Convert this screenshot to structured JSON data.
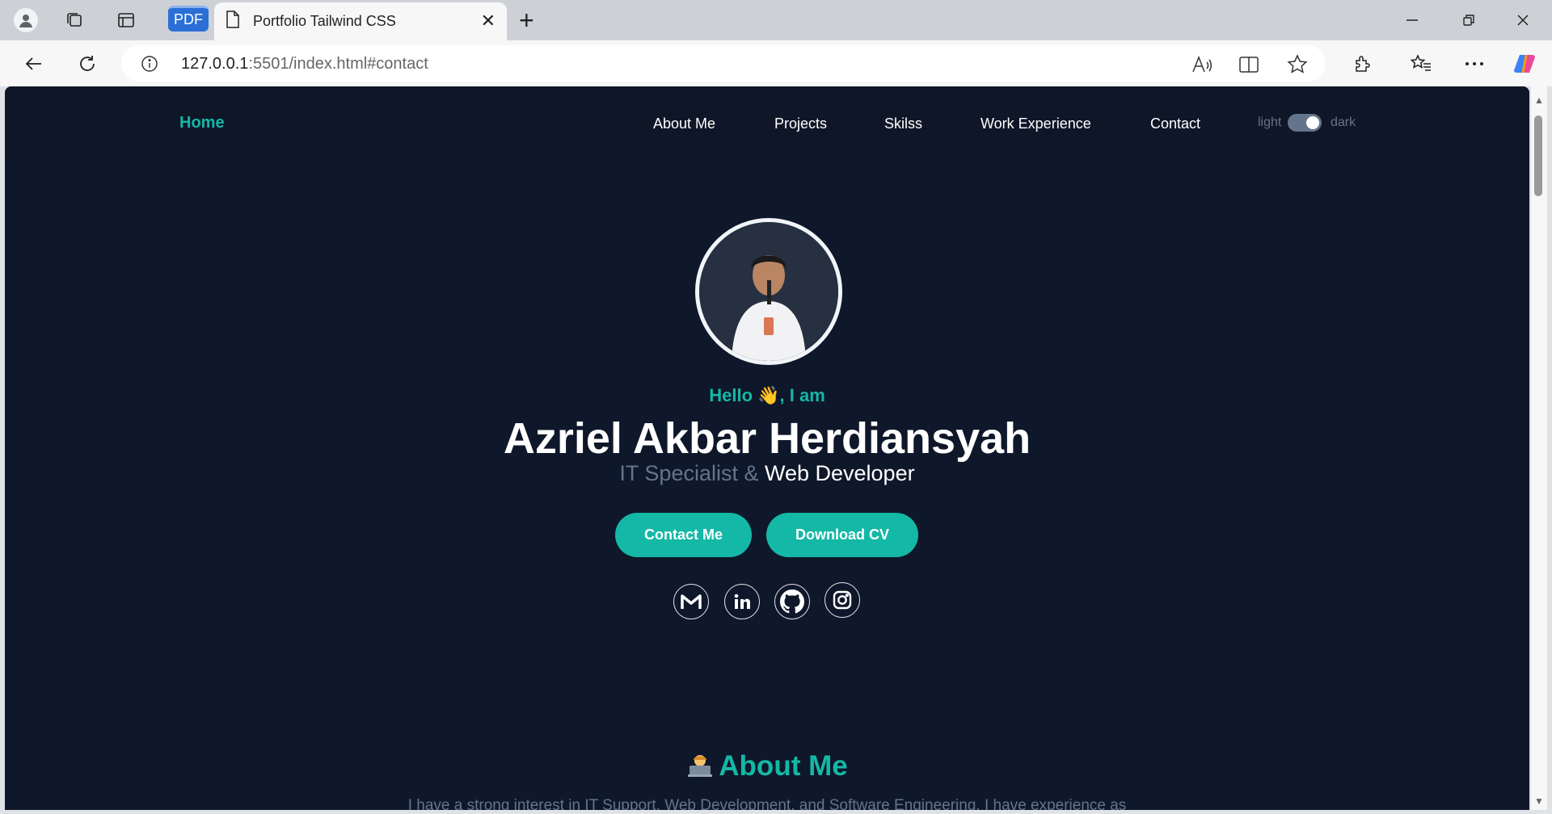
{
  "browser": {
    "pdf_tab_label": "PDF",
    "active_tab_title": "Portfolio Tailwind CSS",
    "url_host": "127.0.0.1",
    "url_rest": ":5501/index.html#contact"
  },
  "site": {
    "brand": "Home",
    "nav": [
      "About Me",
      "Projects",
      "Skilss",
      "Work Experience",
      "Contact"
    ],
    "theme_toggle": {
      "light_label": "light",
      "dark_label": "dark",
      "state": "dark"
    }
  },
  "hero": {
    "greeting": "Hello 👋, I am",
    "name": "Azriel Akbar Herdiansyah",
    "role_part1": "IT Specialist & ",
    "role_part2": "Web Developer",
    "contact_button": "Contact Me",
    "cv_button": "Download CV",
    "social_icons": [
      "gmail-icon",
      "linkedin-icon",
      "github-icon",
      "instagram-icon"
    ]
  },
  "about": {
    "title": "About Me",
    "text": "I have a strong interest in IT Support, Web Development, and Software Engineering. I have experience as"
  },
  "colors": {
    "accent": "#14b8a6",
    "page_bg": "#0f172a",
    "text_muted": "#64748b"
  }
}
